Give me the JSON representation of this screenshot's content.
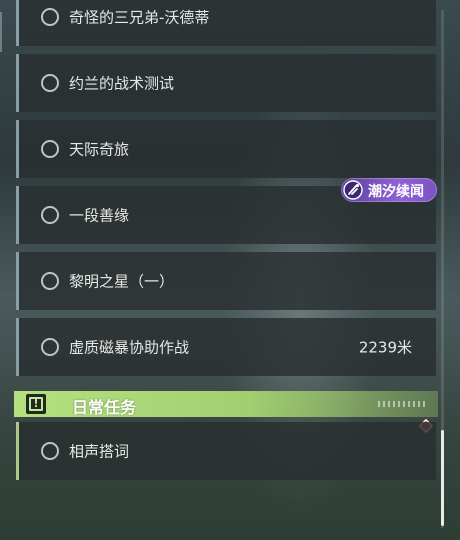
{
  "quests": [
    {
      "title": "奇怪的三兄弟-沃德蒂"
    },
    {
      "title": "约兰的战术测试"
    },
    {
      "title": "天际奇旅"
    },
    {
      "title": "一段善缘"
    },
    {
      "title": "黎明之星（一）"
    },
    {
      "title": "虚质磁暴协助作战",
      "distance": "2239米"
    }
  ],
  "badge": {
    "label": "潮汐续闻",
    "icon": "tide-story-icon",
    "color": "#8e62d6"
  },
  "daily_section": {
    "title": "日常任务",
    "icon": "exclamation-box-icon",
    "accent": "#a9c88a",
    "quests": [
      {
        "title": "相声搭词"
      }
    ]
  },
  "marker": {
    "icon": "red-diamond-marker-icon",
    "color": "#e0505e"
  },
  "scroll": {
    "position": 0.95
  }
}
